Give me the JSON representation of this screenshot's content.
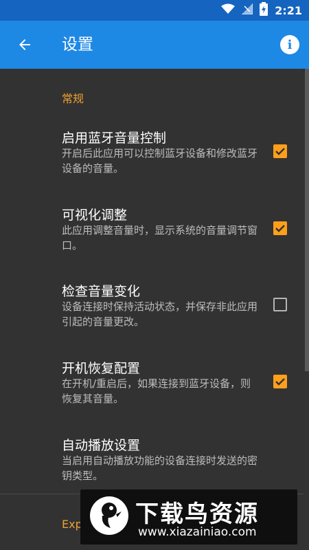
{
  "status_bar": {
    "time": "2:21"
  },
  "toolbar": {
    "title": "设置"
  },
  "section": {
    "header": "常规"
  },
  "prefs": [
    {
      "title": "启用蓝牙音量控制",
      "summary": "开启后此应用可以控制蓝牙设备和修改蓝牙设备的音量。",
      "checked": true
    },
    {
      "title": "可视化调整",
      "summary": "此应用调整音量时，显示系统的音量调节窗口。",
      "checked": true
    },
    {
      "title": "检查音量变化",
      "summary": "设备连接时保持活动状态，并保存非此应用引起的音量更改。",
      "checked": false
    },
    {
      "title": "开机恢复配置",
      "summary": "在开机/重启后，如果连接到蓝牙设备，则恢复其音量。",
      "checked": true
    },
    {
      "title": "自动播放设置",
      "summary": "当启用自动播放功能的设备连接时发送的密钥类型。"
    }
  ],
  "next_section": {
    "header_partial": "Exp"
  },
  "watermark": {
    "title": "下载鸟资源",
    "url": "www.xiazainiao.com"
  },
  "colors": {
    "toolbar": "#1e88e5",
    "status_bar": "#1565c0",
    "accent": "#ff9f1c",
    "background": "#323232"
  }
}
